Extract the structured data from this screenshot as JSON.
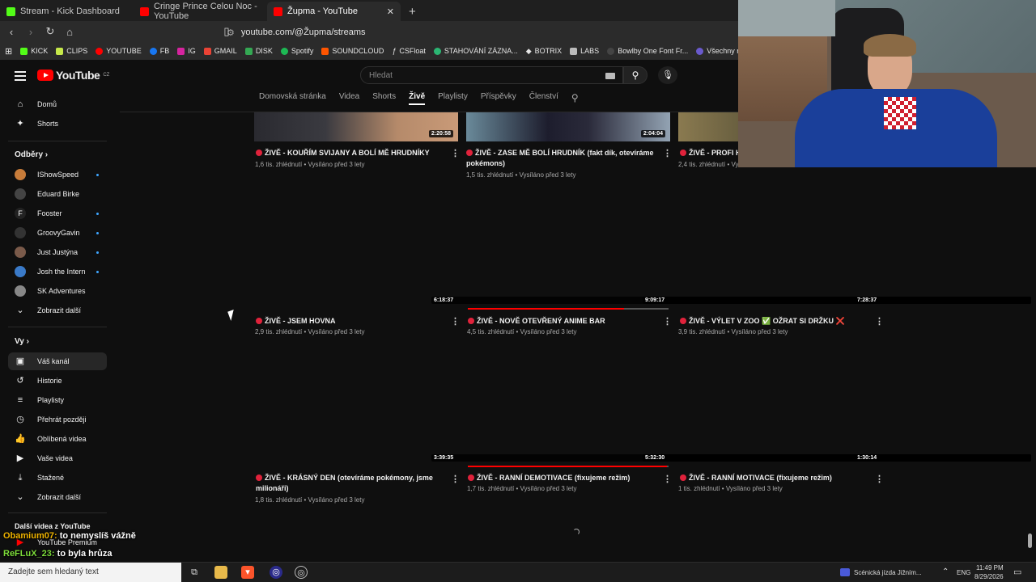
{
  "browser": {
    "tabs": [
      {
        "title": "Stream - Kick Dashboard",
        "color": "#53fc18"
      },
      {
        "title": "Cringe Prince Celou Noc - YouTube",
        "color": "#ff0000"
      },
      {
        "title": "Župma - YouTube",
        "color": "#ff0000"
      }
    ],
    "url": "youtube.com/@Župma/streams",
    "bookmarks": [
      "KICK",
      "CLIPS",
      "YOUTUBE",
      "FB",
      "IG",
      "GMAIL",
      "DISK",
      "Spotify",
      "SOUNDCLOUD",
      "CSFloat",
      "STAHOVÁNÍ ZÁZNA...",
      "BOTRIX",
      "LABS",
      "Bowlby One Font Fr...",
      "Všechny recenze"
    ]
  },
  "youtube": {
    "logo": "YouTube",
    "logo_cc": "CZ",
    "search_placeholder": "Hledat",
    "channel_tabs": [
      "Domovská stránka",
      "Videa",
      "Shorts",
      "Živě",
      "Playlisty",
      "Příspěvky",
      "Členství"
    ],
    "active_tab": "Živě"
  },
  "sidebar": {
    "top": [
      {
        "label": "Domů",
        "icon": "home-icon"
      },
      {
        "label": "Shorts",
        "icon": "shorts-icon"
      }
    ],
    "subs_heading": "Odběry",
    "subs": [
      {
        "label": "IShowSpeed",
        "live": true,
        "color": "#c87c3a"
      },
      {
        "label": "Eduard Birke",
        "live": false,
        "color": "#444"
      },
      {
        "label": "Fooster",
        "live": true,
        "color": "#222"
      },
      {
        "label": "GroovyGavin",
        "live": true,
        "color": "#333"
      },
      {
        "label": "Just Justýna",
        "live": true,
        "color": "#7a5a4a"
      },
      {
        "label": "Josh the Intern",
        "live": true,
        "color": "#3a7ac8"
      },
      {
        "label": "SK Adventures",
        "live": false,
        "color": "#888"
      }
    ],
    "show_more": "Zobrazit další",
    "you_heading": "Vy",
    "you": [
      {
        "label": "Váš kanál",
        "icon": "account-icon"
      },
      {
        "label": "Historie",
        "icon": "history-icon"
      },
      {
        "label": "Playlisty",
        "icon": "playlist-icon"
      },
      {
        "label": "Přehrát později",
        "icon": "clock-icon"
      },
      {
        "label": "Oblíbená videa",
        "icon": "thumbs-up-icon"
      },
      {
        "label": "Vaše videa",
        "icon": "video-icon"
      },
      {
        "label": "Stažené",
        "icon": "download-icon"
      }
    ],
    "show_more_2": "Zobrazit další",
    "more_heading": "Další videa z YouTube",
    "premium": "YouTube Premium"
  },
  "videos": [
    {
      "title": "ŽIVĚ - KOUŘÍM SVIJANY A BOLÍ MĚ HRUDNÍKY",
      "meta": "1,6 tis. zhlédnutí • Vysíláno před 3 lety",
      "duration": "2:20:58",
      "progress": 0
    },
    {
      "title": "ŽIVĚ - ZASE MĚ BOLÍ HRUDNÍK (fakt dík, otevíráme pokémons)",
      "meta": "1,5 tis. zhlédnutí • Vysíláno před 3 lety",
      "duration": "2:04:04",
      "progress": 0
    },
    {
      "title": "ŽIVĚ - PROFI H",
      "meta": "2,4 tis. zhlédnutí • Vy",
      "duration": "",
      "progress": 0
    },
    {
      "title": "ŽIVĚ - JSEM HOVNA",
      "meta": "2,9 tis. zhlédnutí • Vysíláno před 3 lety",
      "duration": "6:18:37",
      "progress": 0
    },
    {
      "title": "ŽIVĚ - NOVĚ OTEVŘENÝ ANIME BAR",
      "meta": "4,5 tis. zhlédnutí • Vysíláno před 3 lety",
      "duration": "9:09:17",
      "progress": 0.78
    },
    {
      "title": "ŽIVĚ - VÝLET V ZOO ✅ OŽRAT SI DRŽKU ❌",
      "meta": "3,9 tis. zhlédnutí • Vysíláno před 3 lety",
      "duration": "7:28:37",
      "progress": 0
    },
    {
      "title": "ŽIVĚ - KRÁSNÝ DEN (otevíráme pokémony, jsme milionáři)",
      "meta": "1,8 tis. zhlédnutí • Vysíláno před 3 lety",
      "duration": "3:39:35",
      "progress": 0
    },
    {
      "title": "ŽIVĚ - RANNÍ DEMOTIVACE (fixujeme režim)",
      "meta": "1,7 tis. zhlédnutí • Vysíláno před 3 lety",
      "duration": "5:32:30",
      "progress": 0.99
    },
    {
      "title": "ŽIVĚ - RANNÍ MOTIVACE (fixujeme režim)",
      "meta": "1 tis. zhlédnutí • Vysíláno před 3 lety",
      "duration": "1:30:14",
      "progress": 0
    }
  ],
  "chat": [
    {
      "user": "Obamium07",
      "msg": "to nemyslíš vážně",
      "color": "#f0b400"
    },
    {
      "user": "ReFLuX_23",
      "msg": "to byla hrůza",
      "color": "#7ddc3a"
    }
  ],
  "taskbar": {
    "search_text": "Zadejte sem hledaný text",
    "media": "Scénická jízda Jižním...",
    "lang": "ENG",
    "time": "11:49 PM",
    "date": "8/29/2026"
  }
}
